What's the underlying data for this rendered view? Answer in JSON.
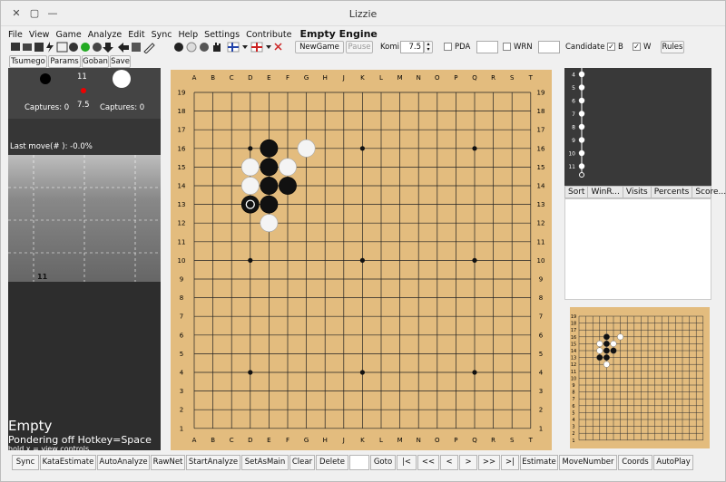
{
  "window": {
    "title": "Lizzie"
  },
  "menu": {
    "items": [
      "File",
      "View",
      "Game",
      "Analyze",
      "Edit",
      "Sync",
      "Help",
      "Settings",
      "Contribute"
    ],
    "engine": "Empty Engine"
  },
  "toolbar": {
    "new_game": "NewGame",
    "pause": "Pause",
    "komi_label": "Komi",
    "komi_value": "7.5",
    "pda": "PDA",
    "wrn": "WRN",
    "candidate": "Candidate",
    "b": "B",
    "w": "W",
    "rules": "Rules"
  },
  "subtoolbar": [
    "Tsumego",
    "Params",
    "Goban",
    "Save"
  ],
  "left": {
    "move_number": "11",
    "komi": "7.5",
    "captures_black": "Captures: 0",
    "captures_white": "Captures: 0",
    "last_move": "Last move(#  ): -0.0%",
    "graph_label": "11",
    "engine_status": "Empty",
    "pondering": "Pondering off  Hotkey=Space",
    "hold_hint": "hold x = view controls"
  },
  "board": {
    "cols": [
      "A",
      "B",
      "C",
      "D",
      "E",
      "F",
      "G",
      "H",
      "J",
      "K",
      "L",
      "M",
      "N",
      "O",
      "P",
      "Q",
      "R",
      "S",
      "T"
    ],
    "rows": [
      "19",
      "18",
      "17",
      "16",
      "15",
      "14",
      "13",
      "12",
      "11",
      "10",
      "9",
      "8",
      "7",
      "6",
      "5",
      "4",
      "3",
      "2",
      "1"
    ],
    "stones": [
      {
        "c": "B",
        "pos": "E16"
      },
      {
        "c": "W",
        "pos": "G16"
      },
      {
        "c": "W",
        "pos": "D15"
      },
      {
        "c": "B",
        "pos": "E15"
      },
      {
        "c": "W",
        "pos": "F15"
      },
      {
        "c": "W",
        "pos": "D14"
      },
      {
        "c": "B",
        "pos": "E14"
      },
      {
        "c": "B",
        "pos": "F14"
      },
      {
        "c": "B",
        "pos": "D13",
        "last": true
      },
      {
        "c": "B",
        "pos": "E13"
      },
      {
        "c": "W",
        "pos": "E12"
      }
    ]
  },
  "right": {
    "move_list": [
      "4",
      "5",
      "6",
      "7",
      "8",
      "9",
      "10",
      "11"
    ],
    "tabs": [
      "Sort",
      "WinR...",
      "Visits",
      "Percents",
      "Score..."
    ]
  },
  "bottombar": [
    "Sync",
    "KataEstimate",
    "AutoAnalyze",
    "RawNet",
    "StartAnalyze",
    "SetAsMain",
    "Clear",
    "Delete",
    "",
    "Goto",
    "|<",
    "<<",
    "<",
    ">",
    ">>",
    ">|",
    "Estimate",
    "MoveNumber",
    "Coords",
    "AutoPlay"
  ]
}
